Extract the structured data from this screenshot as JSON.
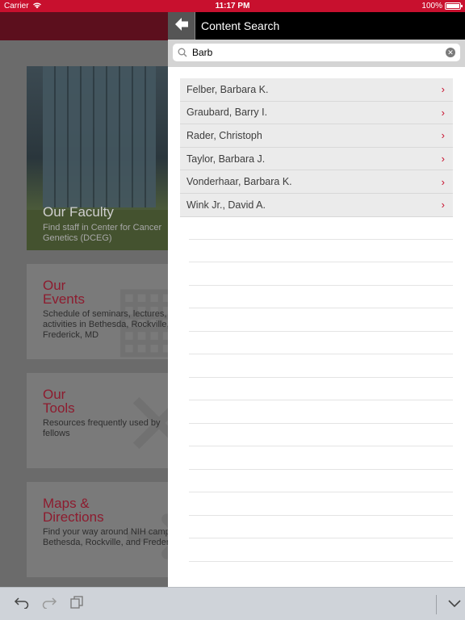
{
  "status": {
    "carrier": "Carrier",
    "time": "11:17 PM",
    "battery": "100%",
    "battery_level": 1.0
  },
  "background": {
    "cards": [
      {
        "title": "Our Faculty",
        "desc": "Find staff in Center for Cancer Genetics (DCEG)"
      },
      {
        "title_line1": "Our",
        "title_line2": "Events",
        "desc": "Schedule of seminars, lectures, activities in Bethesda, Rockville, Frederick, MD"
      },
      {
        "title_line1": "Our",
        "title_line2": "Tools",
        "desc": "Resources frequently used by fellows"
      },
      {
        "title_line1": "Maps &",
        "title_line2": "Directions",
        "desc": "Find your way around NIH campus Bethesda, Rockville, and Frederick"
      }
    ]
  },
  "panel": {
    "title": "Content Search",
    "search": {
      "value": "Barb",
      "placeholder": ""
    },
    "results": [
      "Felber, Barbara K.",
      "Graubard, Barry I.",
      "Rader, Christoph",
      "Taylor, Barbara J.",
      "Vonderhaar, Barbara K.",
      "Wink Jr., David A."
    ]
  },
  "icons": {
    "back": "left-arrow-icon",
    "search": "search-icon",
    "clear": "clear-icon",
    "undo": "undo-icon",
    "redo": "redo-icon",
    "paste": "paste-icon",
    "dismiss": "chevron-down-icon"
  },
  "colors": {
    "accent": "#c8102e",
    "header_dark": "#5c0f1d",
    "title_red": "#8d1c2f"
  }
}
